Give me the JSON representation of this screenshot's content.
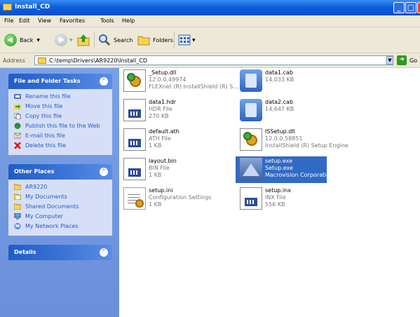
{
  "window": {
    "title": "Install_CD"
  },
  "menu": [
    "File",
    "Edit",
    "View",
    "Favorites",
    "Tools",
    "Help"
  ],
  "toolbar": {
    "back_label": "Back",
    "search_label": "Search",
    "folders_label": "Folders"
  },
  "address": {
    "label": "Address",
    "value": "C:\\temp\\Drivers\\AR9220\\Install_CD",
    "go_label": "Go"
  },
  "file_tasks": {
    "title": "File and Folder Tasks",
    "items": [
      {
        "label": "Rename this file",
        "icon": "rename-icon"
      },
      {
        "label": "Move this file",
        "icon": "move-icon"
      },
      {
        "label": "Copy this file",
        "icon": "copy-icon"
      },
      {
        "label": "Publish this file to the Web",
        "icon": "web-icon"
      },
      {
        "label": "E-mail this file",
        "icon": "email-icon"
      },
      {
        "label": "Delete this file",
        "icon": "delete-icon"
      }
    ]
  },
  "other_places": {
    "title": "Other Places",
    "items": [
      {
        "label": "AR9220",
        "icon": "folder-icon"
      },
      {
        "label": "My Documents",
        "icon": "my-documents-icon"
      },
      {
        "label": "Shared Documents",
        "icon": "folder-icon"
      },
      {
        "label": "My Computer",
        "icon": "computer-icon"
      },
      {
        "label": "My Network Places",
        "icon": "network-icon"
      }
    ]
  },
  "details": {
    "title": "Details"
  },
  "files": [
    {
      "name": "_Setup.dll",
      "line2": "12.0.0.49974",
      "line3": "FLEXnet (R) InstallShield (R) S...",
      "icon": "dll-icon"
    },
    {
      "name": "data1.cab",
      "line2": "14,033 KB",
      "line3": "",
      "icon": "cab-icon"
    },
    {
      "name": "data1.hdr",
      "line2": "HDR File",
      "line3": "270 KB",
      "icon": "file-icon"
    },
    {
      "name": "data2.cab",
      "line2": "14,647 KB",
      "line3": "",
      "icon": "cab-icon"
    },
    {
      "name": "default.ath",
      "line2": "ATH File",
      "line3": "1 KB",
      "icon": "file-icon"
    },
    {
      "name": "ISSetup.dll",
      "line2": "12.0.0.58851",
      "line3": "InstallShield (R) Setup Engine",
      "icon": "dll-icon"
    },
    {
      "name": "layout.bin",
      "line2": "BIN File",
      "line3": "1 KB",
      "icon": "file-icon"
    },
    {
      "name": "setup.exe",
      "line2": "Setup.exe",
      "line3": "Macrovision Corporation",
      "icon": "setup-icon",
      "selected": true
    },
    {
      "name": "setup.ini",
      "line2": "Configuration Settings",
      "line3": "1 KB",
      "icon": "ini-icon"
    },
    {
      "name": "setup.inx",
      "line2": "INX File",
      "line3": "556 KB",
      "icon": "file-icon"
    }
  ],
  "colors": {
    "title_bar": "#0f5fdc",
    "task_pane": "#6b8fd9",
    "selection": "#316ac5"
  }
}
